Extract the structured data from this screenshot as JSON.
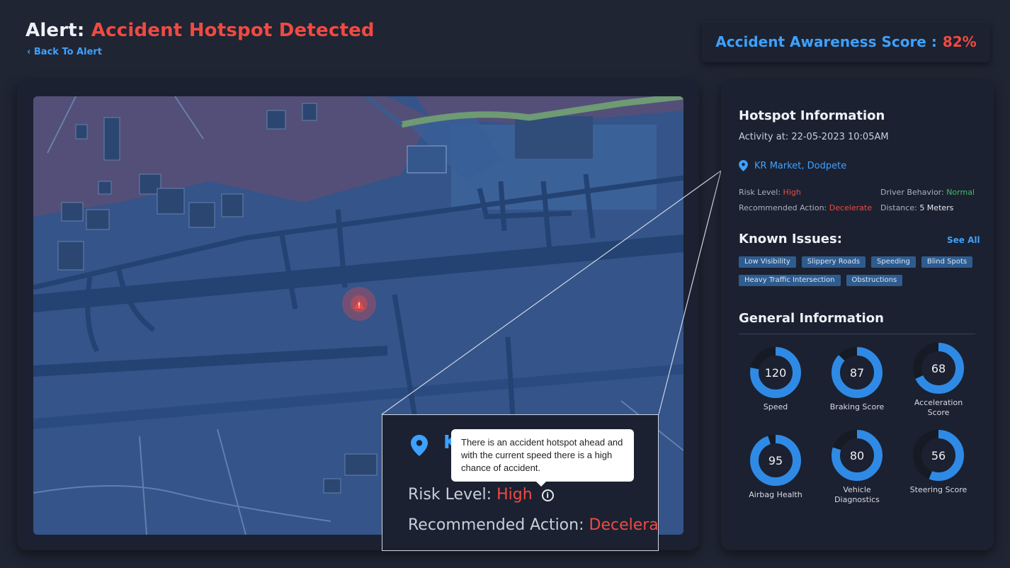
{
  "header": {
    "title_prefix": "Alert:",
    "title_alert": "Accident Hotspot Detected",
    "back_link": "Back To Alert",
    "score_label": "Accident Awareness Score :",
    "score_value": "82%"
  },
  "map": {
    "warning_icon": "warning-triangle-icon"
  },
  "zoom": {
    "location_partial": "K",
    "risk_label": "Risk Level:",
    "risk_value": "High",
    "action_label": "Recommended Action:",
    "action_value": "Decelerat",
    "info_glyph": "i",
    "tooltip": "There is an accident hotspot ahead and with the current speed there is a high chance of accident."
  },
  "hotspot": {
    "title": "Hotspot Information",
    "activity": "Activity at: 22-05-2023 10:05AM",
    "location": "KR Market, Dodpete",
    "risk_label": "Risk Level:",
    "risk_value": "High",
    "driver_label": "Driver Behavior:",
    "driver_value": "Normal",
    "action_label": "Recommended Action:",
    "action_value": "Decelerate",
    "distance_label": "Distance:",
    "distance_value": "5 Meters"
  },
  "known_issues": {
    "title": "Known Issues:",
    "see_all": "See All",
    "tags": [
      "Low Visibility",
      "Slippery Roads",
      "Speeding",
      "Blind Spots",
      "Heavy Traffic Intersection",
      "Obstructions"
    ]
  },
  "general": {
    "title": "General Information",
    "gauges": [
      {
        "value": "120",
        "label": "Speed",
        "fraction": 0.78
      },
      {
        "value": "87",
        "label": "Braking Score",
        "fraction": 0.87
      },
      {
        "value": "68",
        "label": "Acceleration Score",
        "fraction": 0.68
      },
      {
        "value": "95",
        "label": "Airbag Health",
        "fraction": 0.95
      },
      {
        "value": "80",
        "label": "Vehicle Diagnostics",
        "fraction": 0.8
      },
      {
        "value": "56",
        "label": "Steering Score",
        "fraction": 0.56
      }
    ]
  },
  "colors": {
    "accent": "#3ea1ff",
    "danger": "#ef4a43",
    "ok": "#3fbf5f",
    "background": "#1f2533"
  }
}
